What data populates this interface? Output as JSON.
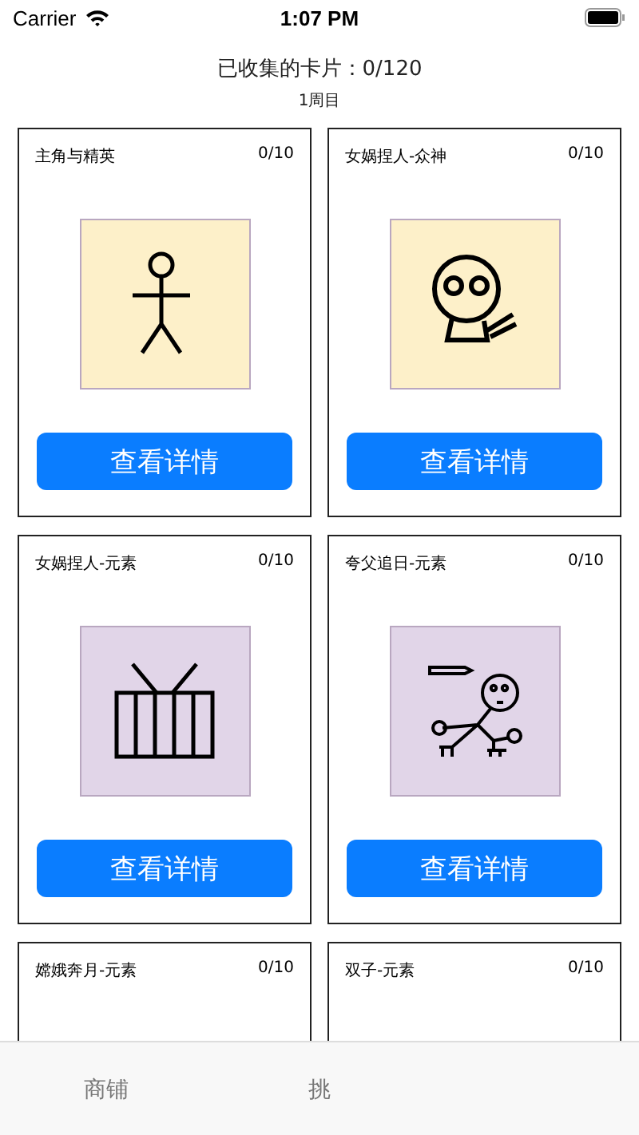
{
  "status_bar": {
    "carrier": "Carrier",
    "time": "1:07 PM"
  },
  "header": {
    "collected": "已收集的卡片：0/120",
    "round": "1周目"
  },
  "cards": [
    {
      "title": "主角与精英",
      "count": "0/10",
      "kind": "stick-figure",
      "color": "#fdf0c9",
      "button": "查看详情"
    },
    {
      "title": "女娲捏人-众神",
      "count": "0/10",
      "kind": "round-face",
      "color": "#fdf0c9",
      "button": "查看详情"
    },
    {
      "title": "女娲捏人-元素",
      "count": "0/10",
      "kind": "fence",
      "color": "#e1d5e8",
      "button": "查看详情"
    },
    {
      "title": "夸父追日-元素",
      "count": "0/10",
      "kind": "running-figure",
      "color": "#e1d5e8",
      "button": "查看详情"
    },
    {
      "title": "嫦娥奔月-元素",
      "count": "0/10"
    },
    {
      "title": "双子-元素",
      "count": "0/10"
    }
  ],
  "tabs": [
    {
      "label": "商铺"
    },
    {
      "label": "挑"
    }
  ]
}
